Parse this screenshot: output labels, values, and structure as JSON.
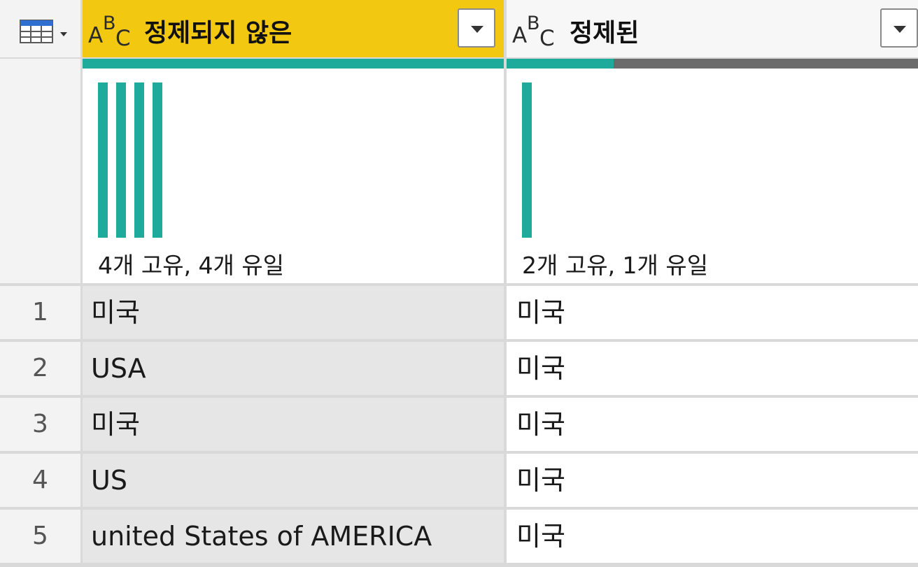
{
  "columns": [
    {
      "type_icon": "text-type-icon",
      "type_letters": {
        "a": "A",
        "b": "B",
        "c": "C"
      },
      "header": "정제되지 않은",
      "selected": true,
      "quality_valid_pct": 100,
      "distribution_counts": [
        1,
        1,
        1,
        1
      ],
      "profile_text": "4개 고유, 4개 유일"
    },
    {
      "type_icon": "text-type-icon",
      "type_letters": {
        "a": "A",
        "b": "B",
        "c": "C"
      },
      "header": "정제된",
      "selected": false,
      "quality_valid_pct": 26,
      "distribution_counts": [
        1
      ],
      "profile_text": "2개 고유, 1개 유일"
    }
  ],
  "rows": [
    {
      "num": "1",
      "c1": "미국",
      "c2": "미국"
    },
    {
      "num": "2",
      "c1": "USA",
      "c2": "미국"
    },
    {
      "num": "3",
      "c1": "미국",
      "c2": "미국"
    },
    {
      "num": "4",
      "c1": "US",
      "c2": "미국"
    },
    {
      "num": "5",
      "c1": "united States of AMERICA",
      "c2": "미국"
    }
  ],
  "colors": {
    "selected_header": "#f2c811",
    "valid": "#1fab9c",
    "error": "#6b6b6b"
  }
}
